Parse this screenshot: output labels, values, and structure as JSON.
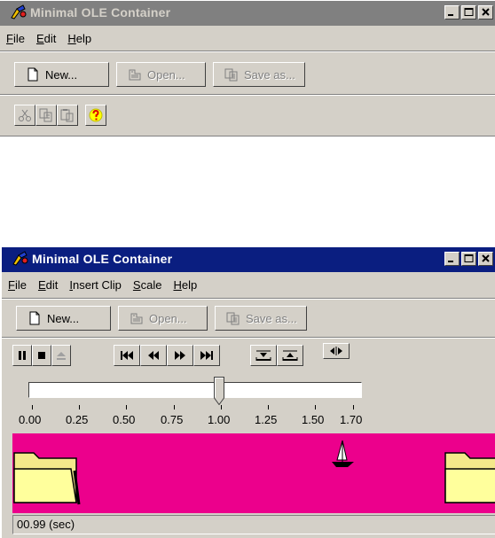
{
  "window1": {
    "title": "Minimal OLE Container",
    "menu": [
      "File",
      "Edit",
      "Help"
    ],
    "toolbar": {
      "new_label": "New...",
      "open_label": "Open...",
      "save_label": "Save as..."
    },
    "small_tools": [
      "cut-icon",
      "copy-icon",
      "paste-icon",
      "help-icon"
    ]
  },
  "window2": {
    "title": "Minimal OLE Container",
    "menu": [
      "File",
      "Edit",
      "Insert Clip",
      "Scale",
      "Help"
    ],
    "toolbar": {
      "new_label": "New...",
      "open_label": "Open...",
      "save_label": "Save as..."
    },
    "player": {
      "slider_value": 0.99,
      "slider_min": 0.0,
      "slider_max": 1.7,
      "tick_labels": [
        "0.00",
        "0.25",
        "0.50",
        "0.75",
        "1.00",
        "1.25",
        "1.50",
        "1.70"
      ],
      "status": "00.99 (sec)"
    },
    "stage_color": "#ec008c"
  },
  "colors": {
    "active_title": "#0a1e80",
    "inactive_title": "#808080",
    "face": "#d4d0c8"
  }
}
